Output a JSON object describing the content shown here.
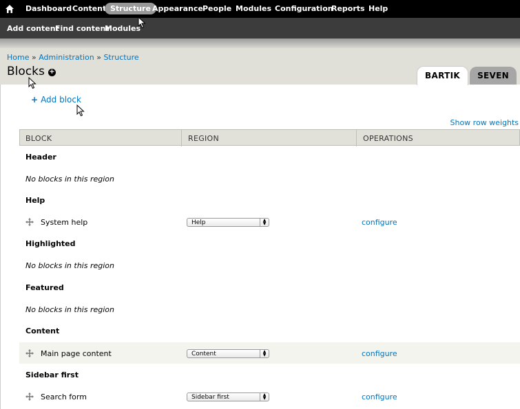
{
  "toolbar": {
    "home_icon": "home-icon",
    "menu": [
      "Dashboard",
      "Content",
      "Structure",
      "Appearance",
      "People",
      "Modules",
      "Configuration",
      "Reports",
      "Help"
    ],
    "active": "Structure"
  },
  "shortcuts": [
    "Add content",
    "Find content",
    "Modules"
  ],
  "breadcrumb": {
    "home": "Home",
    "administration": "Administration",
    "structure": "Structure",
    "separator": "»"
  },
  "page": {
    "title": "Blocks",
    "add_block": "Add block",
    "show_row_weights": "Show row weights"
  },
  "tabs": {
    "bartik": "BARTIK",
    "seven": "SEVEN"
  },
  "table": {
    "headers": {
      "block": "BLOCK",
      "region": "REGION",
      "operations": "OPERATIONS"
    },
    "empty_text": "No blocks in this region",
    "regions": {
      "header": "Header",
      "help": "Help",
      "highlighted": "Highlighted",
      "featured": "Featured",
      "content": "Content",
      "sidebar_first": "Sidebar first"
    },
    "rows": {
      "system_help": {
        "name": "System help",
        "region": "Help",
        "op": "configure"
      },
      "main_content": {
        "name": "Main page content",
        "region": "Content",
        "op": "configure"
      },
      "search_form": {
        "name": "Search form",
        "region": "Sidebar first",
        "op": "configure"
      }
    }
  }
}
